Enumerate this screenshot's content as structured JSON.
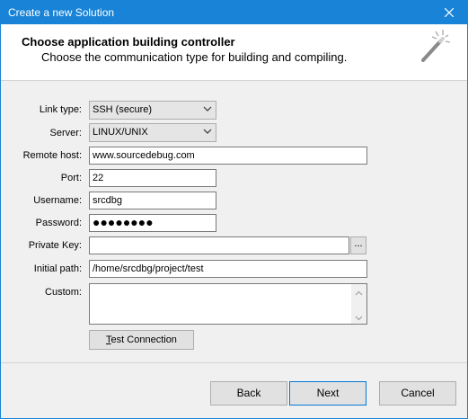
{
  "window": {
    "title": "Create a new Solution"
  },
  "header": {
    "title": "Choose application building controller",
    "subtitle": "Choose the communication type for building and compiling."
  },
  "form": {
    "link_type": {
      "label": "Link type:",
      "value": "SSH (secure)"
    },
    "server": {
      "label": "Server:",
      "value": "LINUX/UNIX"
    },
    "remote_host": {
      "label": "Remote host:",
      "value": "www.sourcedebug.com"
    },
    "port": {
      "label": "Port:",
      "value": "22"
    },
    "username": {
      "label": "Username:",
      "value": "srcdbg"
    },
    "password": {
      "label": "Password:",
      "value": "●●●●●●●●"
    },
    "private_key": {
      "label": "Private Key:",
      "value": "",
      "browse_label": "..."
    },
    "initial_path": {
      "label": "Initial path:",
      "value": "/home/srcdbg/project/test"
    },
    "custom": {
      "label": "Custom:",
      "value": ""
    },
    "test_connection": {
      "label_pre": "",
      "label_mnemonic": "T",
      "label_post": "est Connection"
    }
  },
  "buttons": {
    "back": "Back",
    "next": "Next",
    "cancel": "Cancel"
  },
  "icons": {
    "close": "close-icon",
    "wand": "magic-wand-icon",
    "chevron": "chevron-down-icon"
  },
  "colors": {
    "titlebar": "#1883d7",
    "accent": "#0078d7"
  }
}
